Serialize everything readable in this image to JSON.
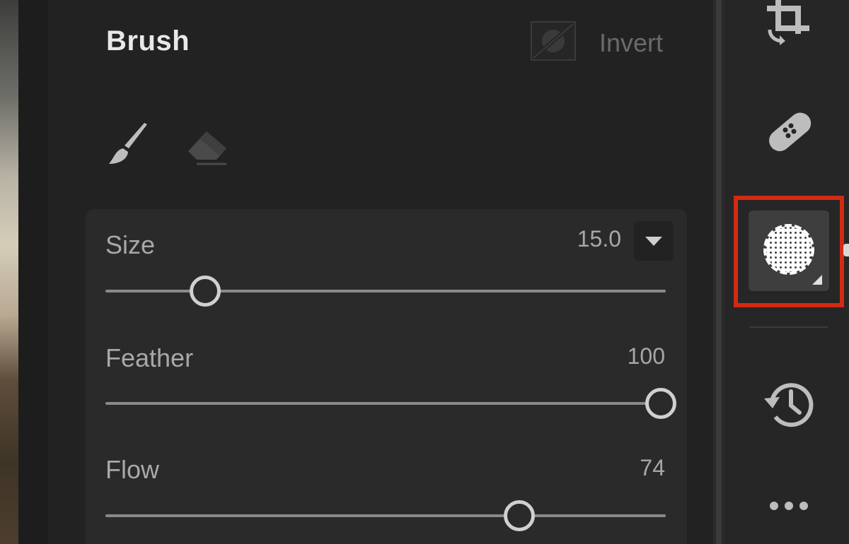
{
  "panel": {
    "title": "Brush",
    "invert_label": "Invert"
  },
  "tools": [
    {
      "name": "brush",
      "icon": "paintbrush-icon",
      "active": true
    },
    {
      "name": "eraser",
      "icon": "eraser-icon",
      "active": false
    }
  ],
  "sliders": {
    "size": {
      "label": "Size",
      "value": "15.0",
      "level": 0.17
    },
    "feather": {
      "label": "Feather",
      "value": "100",
      "level": 1.0
    },
    "flow": {
      "label": "Flow",
      "value": "74",
      "level": 0.74
    }
  },
  "right_toolbar": [
    {
      "icon": "crop-rotate-icon"
    },
    {
      "icon": "healing-bandage-icon"
    },
    {
      "icon": "masking-icon",
      "selected": true
    },
    {
      "icon": "history-icon"
    },
    {
      "icon": "more-icon"
    }
  ],
  "colors": {
    "panel_bg": "#222222",
    "card_bg": "#2a2a2a",
    "highlight": "#d42a12",
    "text_primary": "#e8e8e8",
    "text_secondary": "#a8a8a8"
  }
}
